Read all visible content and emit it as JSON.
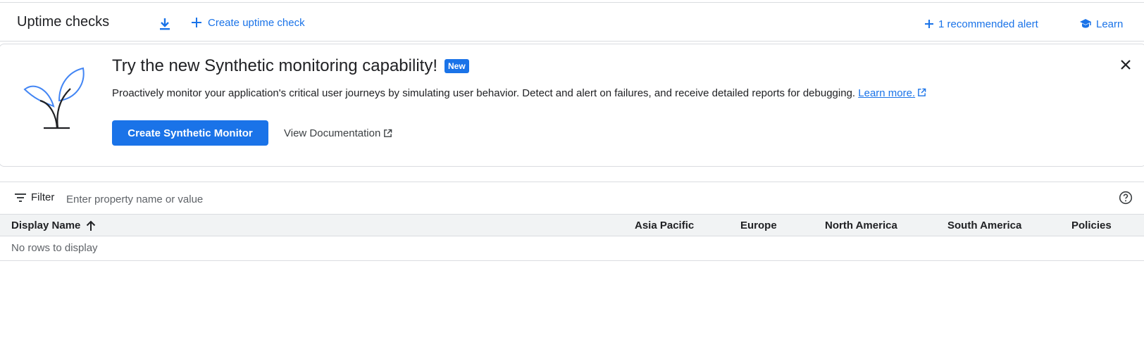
{
  "header": {
    "title": "Uptime checks",
    "download_icon": "download-icon",
    "create_label": "Create uptime check",
    "recommended_label": "1 recommended alert",
    "learn_label": "Learn"
  },
  "banner": {
    "illustration": "plant-icon",
    "title": "Try the new Synthetic monitoring capability!",
    "badge": "New",
    "description": "Proactively monitor your application's critical user journeys by simulating user behavior. Detect and alert on failures, and receive detailed reports for debugging.",
    "learn_more": "Learn more.",
    "primary_button": "Create Synthetic Monitor",
    "doc_link": "View Documentation",
    "close_icon": "close-icon"
  },
  "filter": {
    "label": "Filter",
    "placeholder": "Enter property name or value",
    "help_icon": "help-icon"
  },
  "table": {
    "columns": [
      "Display Name",
      "Asia Pacific",
      "Europe",
      "North America",
      "South America",
      "Policies"
    ],
    "sort_icon": "arrow-up-icon",
    "empty_message": "No rows to display"
  },
  "colors": {
    "accent": "#1a73e8",
    "header_bg": "#f1f3f4",
    "border": "#dadce0"
  }
}
